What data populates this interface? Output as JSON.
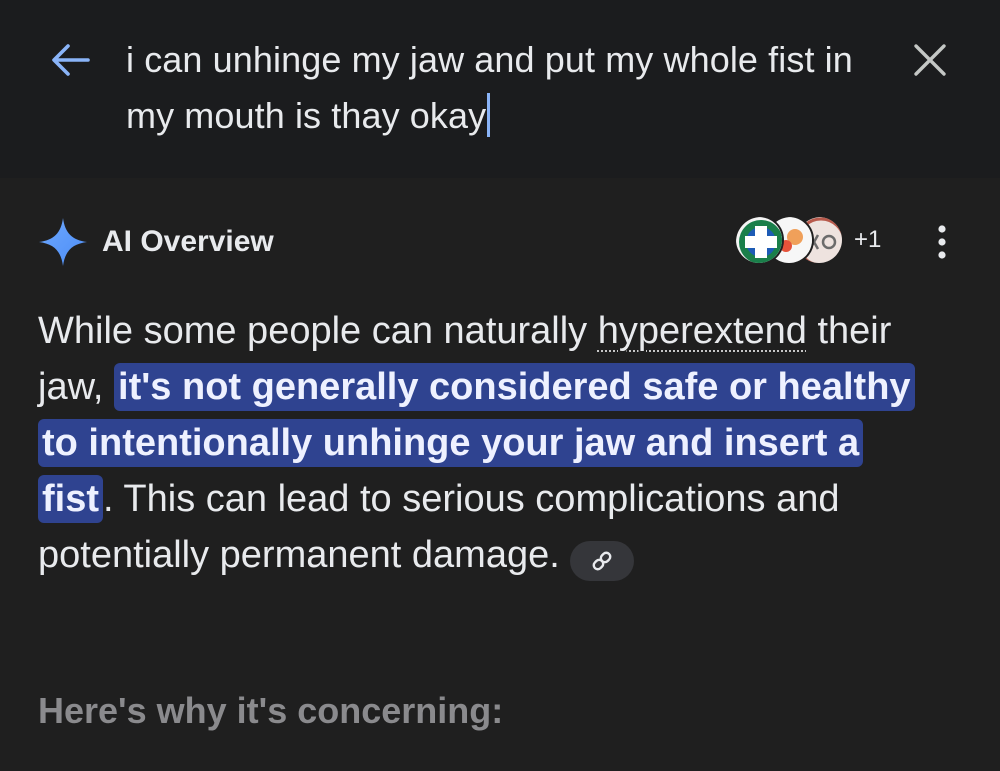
{
  "search": {
    "query": "i can unhinge my jaw and put my whole fist in my mouth is thay okay"
  },
  "icons": {
    "back": "arrow-back-icon",
    "close": "close-icon",
    "ai": "sparkle-icon",
    "more": "more-vert-icon",
    "link": "link-icon"
  },
  "ai_overview": {
    "title": "AI Overview",
    "sources_more": "+1",
    "body_before": "While some people can naturally ",
    "term": "hyperextend",
    "body_mid": " their jaw, ",
    "highlight": "it's not generally considered safe or healthy to intentionally unhinge your jaw and insert a fist",
    "body_after": ". This can lead to serious complications and potentially permanent damage.",
    "subheading": "Here's why it's concerning:"
  },
  "colors": {
    "background": "#1f1f1f",
    "search_bar": "#1b1c1e",
    "accent_blue": "#8ab4f8",
    "highlight_bg": "#2f4390",
    "muted_text": "#8a8a8d"
  }
}
